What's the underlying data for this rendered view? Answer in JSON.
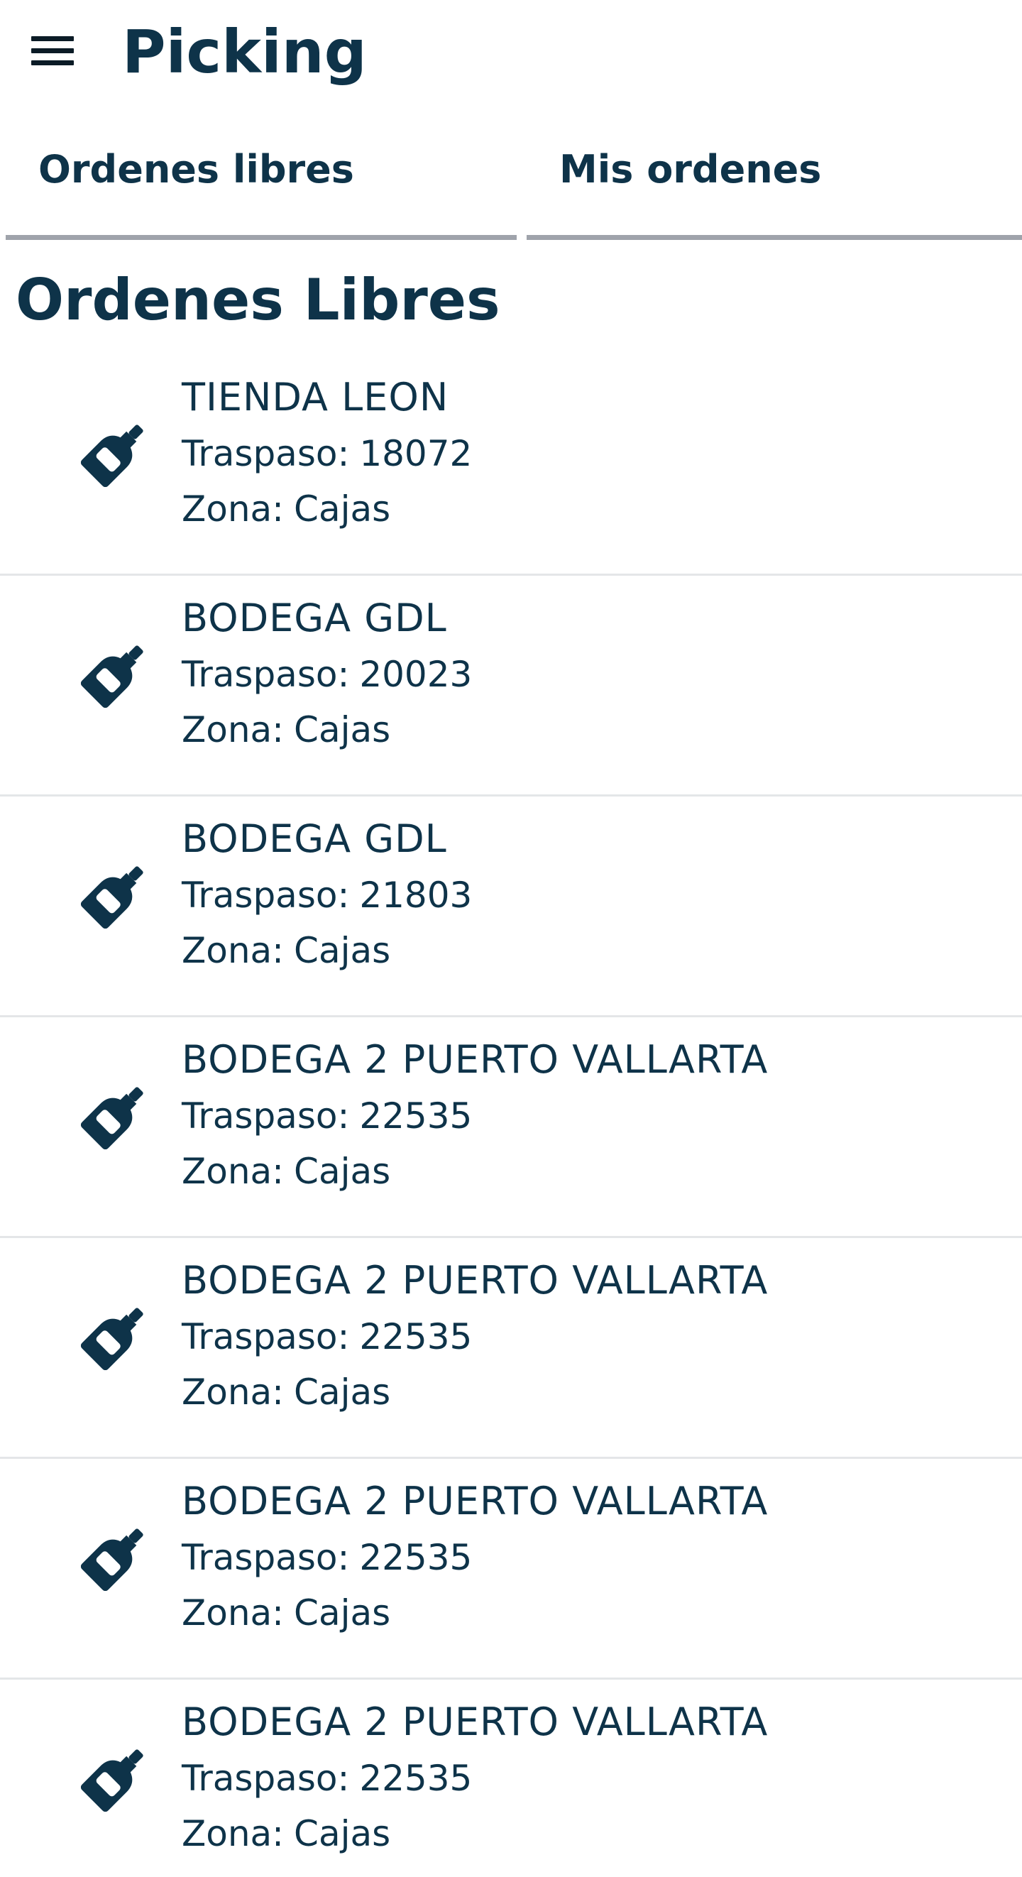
{
  "header": {
    "menu_icon": "hamburger-menu-icon",
    "title": "Picking"
  },
  "tabs": [
    {
      "label": "Ordenes libres"
    },
    {
      "label": "Mis ordenes"
    }
  ],
  "section_title": "Ordenes Libres",
  "colors": {
    "primary_text": "#0e3349",
    "tab_underline": "#9fa3ab",
    "divider": "#e4e6e8"
  },
  "orders": [
    {
      "icon": "bottle-icon",
      "name": "TIENDA LEON",
      "traspaso_label": "Traspaso:",
      "traspaso": "18072",
      "zona_label": "Zona:",
      "zona": "Cajas"
    },
    {
      "icon": "bottle-icon",
      "name": "BODEGA GDL",
      "traspaso_label": "Traspaso:",
      "traspaso": "20023",
      "zona_label": "Zona:",
      "zona": "Cajas"
    },
    {
      "icon": "bottle-icon",
      "name": "BODEGA GDL",
      "traspaso_label": "Traspaso:",
      "traspaso": "21803",
      "zona_label": "Zona:",
      "zona": "Cajas"
    },
    {
      "icon": "bottle-icon",
      "name": "BODEGA 2 PUERTO VALLARTA",
      "traspaso_label": "Traspaso:",
      "traspaso": "22535",
      "zona_label": "Zona:",
      "zona": "Cajas"
    },
    {
      "icon": "bottle-icon",
      "name": "BODEGA 2 PUERTO VALLARTA",
      "traspaso_label": "Traspaso:",
      "traspaso": "22535",
      "zona_label": "Zona:",
      "zona": "Cajas"
    },
    {
      "icon": "bottle-icon",
      "name": "BODEGA 2 PUERTO VALLARTA",
      "traspaso_label": "Traspaso:",
      "traspaso": "22535",
      "zona_label": "Zona:",
      "zona": "Cajas"
    },
    {
      "icon": "bottle-icon",
      "name": "BODEGA 2 PUERTO VALLARTA",
      "traspaso_label": "Traspaso:",
      "traspaso": "22535",
      "zona_label": "Zona:",
      "zona": "Cajas"
    }
  ]
}
